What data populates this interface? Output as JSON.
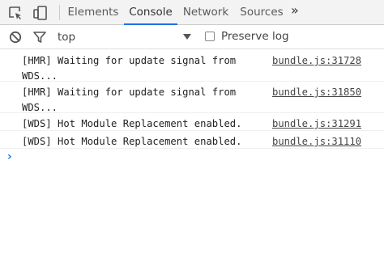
{
  "tabs": [
    "Elements",
    "Console",
    "Network",
    "Sources"
  ],
  "active_tab": "Console",
  "more_tabs_glyph": "»",
  "toolbar": {
    "context": "top",
    "preserve_log_label": "Preserve log",
    "preserve_log_checked": false
  },
  "messages": [
    {
      "text": "[HMR] Waiting for update signal from\nWDS...",
      "source": "bundle.js:31728"
    },
    {
      "text": "[HMR] Waiting for update signal from\nWDS...",
      "source": "bundle.js:31850"
    },
    {
      "text": "[WDS] Hot Module Replacement enabled.",
      "source": "bundle.js:31291"
    },
    {
      "text": "[WDS] Hot Module Replacement enabled.",
      "source": "bundle.js:31110"
    }
  ],
  "prompt_glyph": "›",
  "icons": {
    "inspect": "inspect-element-icon",
    "device": "device-toolbar-icon",
    "clear": "clear-console-icon",
    "filter": "filter-icon"
  },
  "colors": {
    "accent": "#1a73e8"
  }
}
